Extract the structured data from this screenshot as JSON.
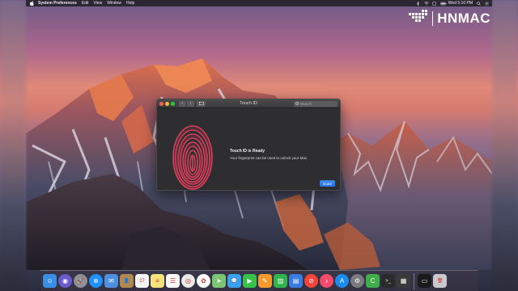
{
  "menubar": {
    "app_name": "System Preferences",
    "items": [
      "Edit",
      "View",
      "Window",
      "Help"
    ],
    "clock": "Wed 5:10 PM"
  },
  "watermark": {
    "text": "HNMAC"
  },
  "window": {
    "title": "Touch ID",
    "search_placeholder": "Search",
    "heading": "Touch ID is Ready",
    "description": "Your fingerprint can be used to unlock your Mac.",
    "done_label": "Done"
  },
  "dock": {
    "icons": [
      {
        "name": "finder-icon",
        "color": "#3a8ee6",
        "glyph": "☺"
      },
      {
        "name": "siri-icon",
        "color": "#6a5acd",
        "glyph": "◉"
      },
      {
        "name": "launchpad-icon",
        "color": "#8e8e93",
        "glyph": "🚀"
      },
      {
        "name": "safari-icon",
        "color": "#1e90ff",
        "glyph": "⊕"
      },
      {
        "name": "mail-icon",
        "color": "#4d8fe0",
        "glyph": "✉"
      },
      {
        "name": "contacts-icon",
        "color": "#b08850",
        "glyph": "👤"
      },
      {
        "name": "calendar-icon",
        "color": "#f5f5f5",
        "glyph": "27"
      },
      {
        "name": "notes-icon",
        "color": "#f6e27a",
        "glyph": "≡"
      },
      {
        "name": "reminders-icon",
        "color": "#fafafa",
        "glyph": "☰"
      },
      {
        "name": "chrome-icon",
        "color": "#e9e9e9",
        "glyph": "◎"
      },
      {
        "name": "photos-icon",
        "color": "#ffffff",
        "glyph": "✿"
      },
      {
        "name": "maps-icon",
        "color": "#7cc576",
        "glyph": "➤"
      },
      {
        "name": "messages-icon",
        "color": "#3aa0f0",
        "glyph": "💬"
      },
      {
        "name": "facetime-icon",
        "color": "#39c24a",
        "glyph": "▶"
      },
      {
        "name": "pages-icon",
        "color": "#f39a2e",
        "glyph": "✎"
      },
      {
        "name": "numbers-icon",
        "color": "#2fb34a",
        "glyph": "▥"
      },
      {
        "name": "keynote-icon",
        "color": "#3a7be0",
        "glyph": "▤"
      },
      {
        "name": "news-icon",
        "color": "#f4453b",
        "glyph": "⊘"
      },
      {
        "name": "music-icon",
        "color": "#f14a6a",
        "glyph": "♪"
      },
      {
        "name": "app-store-icon",
        "color": "#1a8cf0",
        "glyph": "A"
      },
      {
        "name": "system-preferences-icon",
        "color": "#7a7a80",
        "glyph": "⚙"
      },
      {
        "name": "camtasia-icon",
        "color": "#3fae4a",
        "glyph": "C"
      },
      {
        "name": "terminal-icon",
        "color": "#2a2a2a",
        "glyph": ">_"
      },
      {
        "name": "final-cut-icon",
        "color": "#3a3a3a",
        "glyph": "▦"
      },
      {
        "name": "downloads-stack-icon",
        "color": "#1a1a1a",
        "glyph": "▭"
      },
      {
        "name": "trash-icon",
        "color": "#c9c9cc",
        "glyph": "🗑"
      }
    ]
  }
}
